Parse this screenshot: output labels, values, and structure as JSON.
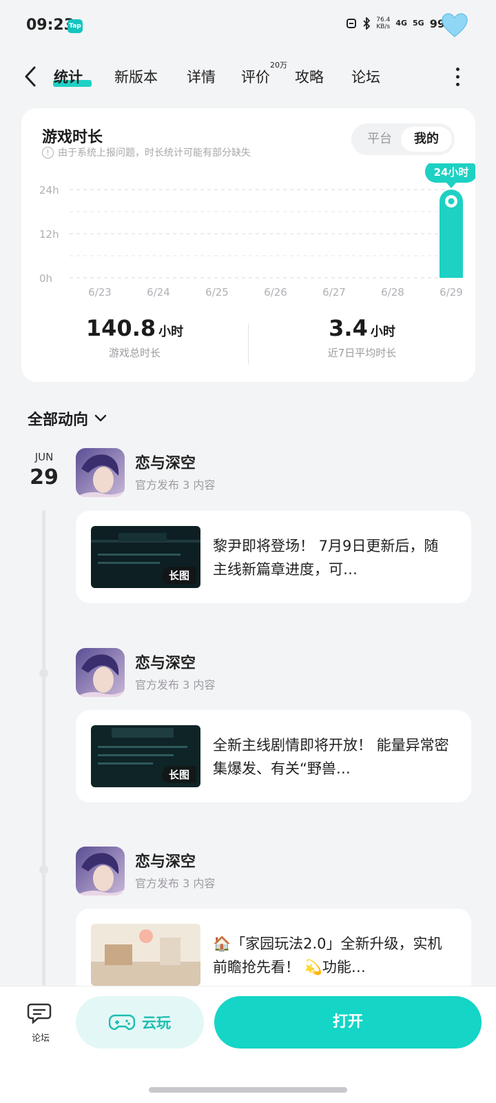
{
  "status_bar": {
    "time": "09:23",
    "tap_badge": "Tap",
    "net_speed": "76.4",
    "net_unit": "KB/s",
    "sig1": "4G",
    "sig2": "5G",
    "battery": "99%"
  },
  "tabs": [
    {
      "label": "统计",
      "active": true
    },
    {
      "label": "新版本"
    },
    {
      "label": "详情"
    },
    {
      "label": "评价"
    },
    {
      "label": "攻略"
    },
    {
      "label": "论坛"
    }
  ],
  "tab_badge": "20万",
  "stats_card": {
    "title": "游戏时长",
    "notice": "由于系统上报问题，时长统计可能有部分缺失",
    "toggle_left": "平台",
    "toggle_right": "我的",
    "total_value": "140.8",
    "total_unit": "小时",
    "total_label": "游戏总时长",
    "avg_value": "3.4",
    "avg_unit": "小时",
    "avg_label": "近7日平均时长"
  },
  "chart_data": {
    "type": "bar",
    "categories": [
      "6/23",
      "6/24",
      "6/25",
      "6/26",
      "6/27",
      "6/28",
      "6/29"
    ],
    "values": [
      0,
      0,
      0,
      0,
      0,
      0,
      24
    ],
    "ylim": [
      0,
      24
    ],
    "y_ticks": [
      "0h",
      "12h",
      "24h"
    ],
    "tooltip": "24小时",
    "accent_color": "#1dd1c3",
    "grid": true
  },
  "activity": {
    "header": "全部动向",
    "month": "JUN",
    "day": "29",
    "posts": [
      {
        "name": "恋与深空",
        "sub": "官方发布 3 内容",
        "tag": "长图",
        "text": "黎尹即将登场！ 7月9日更新后，随主线新篇章进度，可…"
      },
      {
        "name": "恋与深空",
        "sub": "官方发布 3 内容",
        "tag": "长图",
        "text": "全新主线剧情即将开放！ 能量异常密集爆发、有关“野兽…"
      },
      {
        "name": "恋与深空",
        "sub": "官方发布 3 内容",
        "text": "🏠「家园玩法2.0」全新升级，实机前瞻抢先看！ 💫功能…"
      }
    ]
  },
  "bottom_bar": {
    "forum_label": "论坛",
    "cloud_label": "云玩",
    "open_label": "打开"
  }
}
